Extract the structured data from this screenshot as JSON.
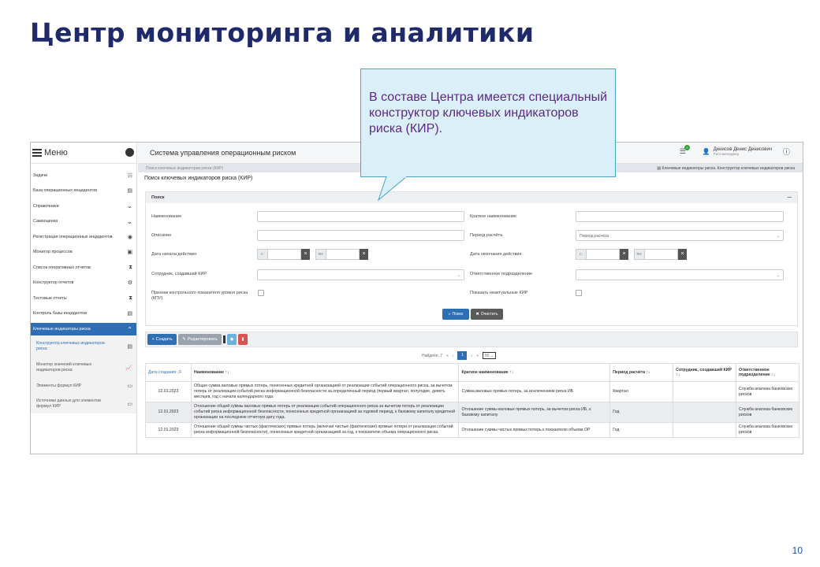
{
  "slide": {
    "title": "Центр мониторинга и аналитики",
    "page_number": "10",
    "callout": "В составе Центра имеется специальный конструктор ключевых индикаторов риска (КИР)."
  },
  "app": {
    "menu_label": "Меню",
    "title": "Система управления операционным риском",
    "tasks_count": "0",
    "user_name": "Денисов Денис Денисович",
    "user_role": "Риск-менеджер",
    "breadcrumb_left": "Поиск ключевых индикаторов риска (КИР)",
    "breadcrumb_right": "Ключевые индикаторы риска. Конструктор ключевых индикаторов риска",
    "page_title": "Поиск ключевых индикаторов риска (КИР)"
  },
  "sidebar": {
    "items": [
      {
        "label": "Задачи",
        "icon": "list-icon"
      },
      {
        "label": "База операционных инцидентов",
        "icon": "table-icon"
      },
      {
        "label": "Справочники",
        "icon": "chevron-down-icon"
      },
      {
        "label": "Самооценка",
        "icon": "chevron-down-icon"
      },
      {
        "label": "Регистрация операционных инцидентов",
        "icon": "target-icon"
      },
      {
        "label": "Монитор процессов",
        "icon": "monitor-icon"
      },
      {
        "label": "Список оперативных отчетов",
        "icon": "hourglass-icon"
      },
      {
        "label": "Конструктор отчетов",
        "icon": "gears-icon"
      },
      {
        "label": "Тестовые отчеты",
        "icon": "hourglass-icon"
      },
      {
        "label": "Контроль базы инцидентов",
        "icon": "table-icon"
      }
    ],
    "active_group": "Ключевые индикаторы риска",
    "sub_items": [
      {
        "label": "Конструктор ключевых индикаторов риска",
        "icon": "table-icon"
      },
      {
        "label": "Монитор значений ключевых индикаторов риска",
        "icon": "chart-icon"
      },
      {
        "label": "Элементы формул КИР",
        "icon": "doc-icon"
      },
      {
        "label": "Источники данных для элементов формул КИР",
        "icon": "doc-icon"
      }
    ]
  },
  "search": {
    "panel_title": "Поиск",
    "collapse_symbol": "—",
    "name_label": "Наименование",
    "short_name_label": "Краткое наименование",
    "description_label": "Описание",
    "period_label": "Период расчёта",
    "period_placeholder": "Период расчёта",
    "start_date_label": "Дата начала действия",
    "end_date_label": "Дата окончания действия",
    "from_label": "с:",
    "to_label": "по:",
    "creator_label": "Сотрудник, создавший КИР",
    "department_label": "Ответственное подразделение",
    "control_flag_label": "Признак контрольного показателя уровня риска (КПУ)",
    "show_inactive_label": "Показать неактуальные КИР",
    "search_button": "Поиск",
    "clear_button": "Очистить"
  },
  "toolbar": {
    "create_button": "Создать",
    "edit_button": "Редактировать"
  },
  "pager": {
    "found_label": "Найдено: 7",
    "first": "«",
    "prev": "‹",
    "current": "1",
    "next": "›",
    "last": "»",
    "page_size": "50"
  },
  "table": {
    "headers": [
      "Дата создания ↓F",
      "Наименование ↑↓",
      "Краткое наименование ↑↓",
      "Период расчёта ↑↓",
      "Сотрудник, создавший КИР ↑↓",
      "Ответственное подразделение ↑↓"
    ],
    "rows": [
      {
        "date": "12.01.2023",
        "name": "Общая сумма валовых прямых потерь, понесенных кредитной организацией от реализации событий операционного риска, за вычетом потерь от реализации событий риска информационной безопасности за определенный период (первый квартал, полугодие, девять месяцев, год с начала календарного года.",
        "short": "Сумма валовых прямых потерь, за исключением риска ИБ",
        "period": "Квартал",
        "creator": "",
        "dept": "Служба анализа банковских рисков"
      },
      {
        "date": "12.01.2023",
        "name": "Отношение общей суммы валовых прямых потерь от реализации событий операционного риска за вычетом потерь от реализации событий риска информационной безопасности, понесенных кредитной организацией за годовой период, к базовому капиталу кредитной организации на последнюю отчетную дату года.",
        "short": "Отношение суммы валовых прямых потерь, за вычетом риска ИБ, к базовому капиталу",
        "period": "Год",
        "creator": "",
        "dept": "Служба анализа банковских рисков"
      },
      {
        "date": "12.01.2023",
        "name": "Отношение общей суммы чистых (фактических) прямых потерь (включая чистые (фактические) прямые потери от реализации событий риска информационной безопасности), понесенных кредитной организацией за год, к показателю объема операционного риска.",
        "short": "Отношение суммы чистых прямых потерь к показателю объема ОР",
        "period": "Год",
        "creator": "",
        "dept": "Служба анализа банковских рисков"
      }
    ]
  }
}
